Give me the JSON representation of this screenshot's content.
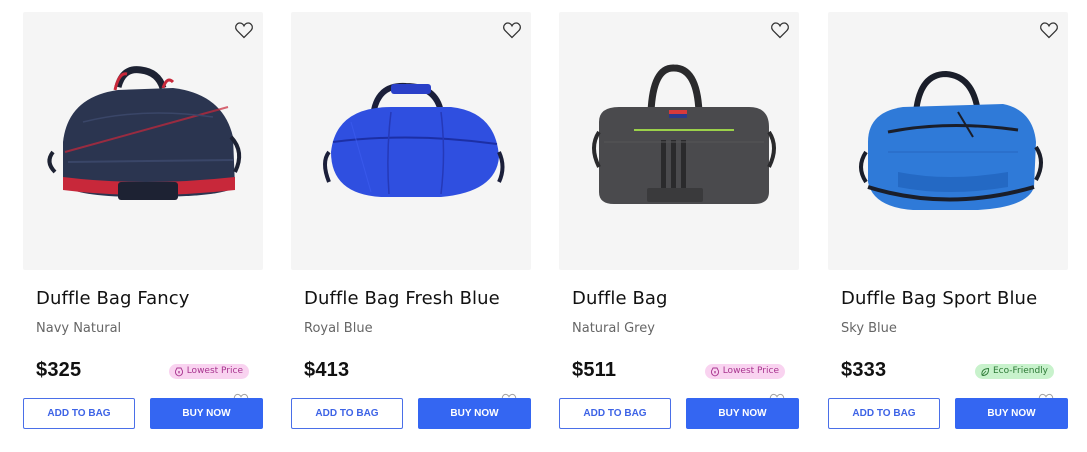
{
  "products": [
    {
      "title": "Duffle Bag Fancy",
      "variant": "Navy Natural",
      "price": "$325",
      "badge": {
        "label": "Lowest Price",
        "kind": "pink",
        "icon": "price-tag-icon"
      },
      "add_label": "ADD TO BAG",
      "buy_label": "BUY NOW",
      "image": {
        "icon": "duffle-bag-image",
        "color": "#2b3550",
        "trim": "#c8283a"
      }
    },
    {
      "title": "Duffle Bag Fresh Blue",
      "variant": "Royal Blue",
      "price": "$413",
      "badge": null,
      "add_label": "ADD TO BAG",
      "buy_label": "BUY NOW",
      "image": {
        "icon": "duffle-bag-image",
        "color": "#2f4fe0",
        "trim": "#1b1f3a"
      }
    },
    {
      "title": "Duffle Bag",
      "variant": "Natural Grey",
      "price": "$511",
      "badge": {
        "label": "Lowest Price",
        "kind": "pink",
        "icon": "price-tag-icon"
      },
      "add_label": "ADD TO BAG",
      "buy_label": "BUY NOW",
      "image": {
        "icon": "duffle-bag-image",
        "color": "#4a4a4d",
        "trim": "#2a2a2c"
      }
    },
    {
      "title": "Duffle Bag Sport Blue",
      "variant": "Sky Blue",
      "price": "$333",
      "badge": {
        "label": "Eco-Friendly",
        "kind": "green",
        "icon": "leaf-icon"
      },
      "add_label": "ADD TO BAG",
      "buy_label": "BUY NOW",
      "image": {
        "icon": "duffle-bag-image",
        "color": "#2f7ad8",
        "trim": "#1a1e2a"
      }
    }
  ],
  "colors": {
    "accent": "#3466f2",
    "badge_pink_bg": "#f9d3f0",
    "badge_green_bg": "#c8f2cc"
  }
}
